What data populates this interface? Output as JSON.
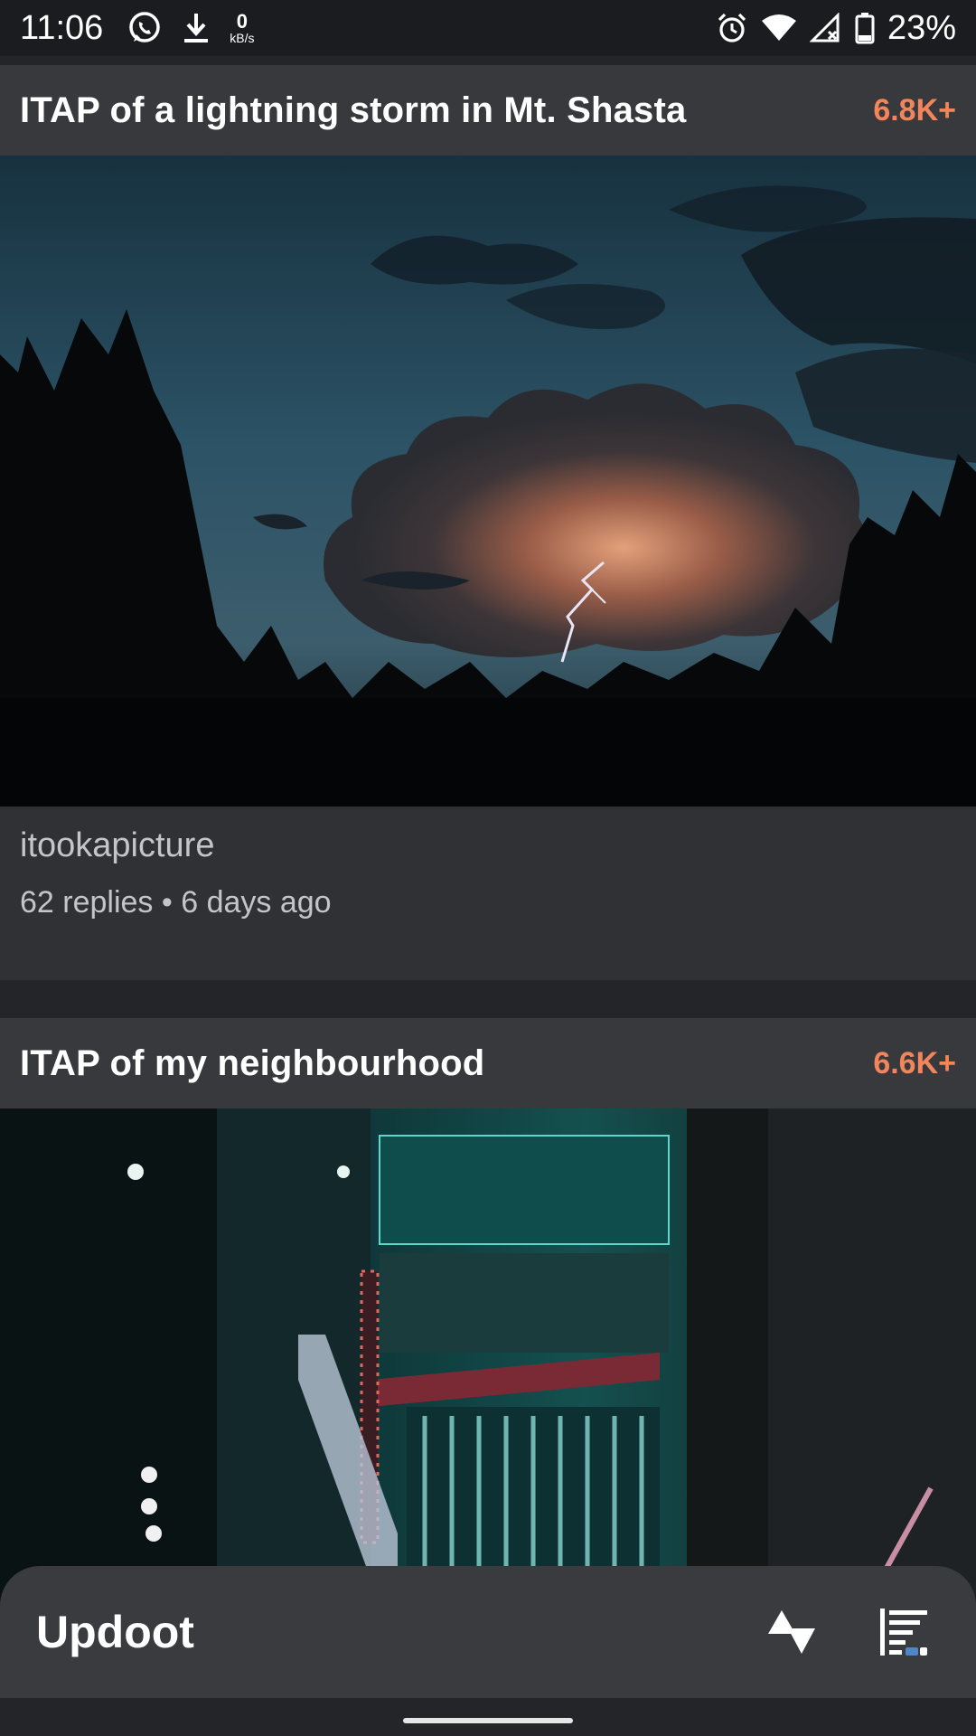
{
  "status_bar": {
    "time": "11:06",
    "net_speed_value": "0",
    "net_speed_unit": "kB/s",
    "battery": "23%",
    "icons": [
      "whatsapp-icon",
      "download-icon",
      "alarm-icon",
      "wifi-icon",
      "signal-icon",
      "battery-icon"
    ]
  },
  "posts": [
    {
      "title": "ITAP of a lightning storm in Mt. Shasta",
      "score": "6.8K+",
      "subreddit": "itookapicture",
      "info": "62 replies • 6 days ago"
    },
    {
      "title": "ITAP of my neighbourhood",
      "score": "6.6K+"
    }
  ],
  "bottom_bar": {
    "app_name": "Updoot",
    "icons": [
      "sort-updown-icon",
      "feed-menu-icon"
    ]
  },
  "colors": {
    "score": "#f2855b",
    "card": "#303134",
    "background": "#242528",
    "bottom_bar": "#3a3b3e"
  }
}
